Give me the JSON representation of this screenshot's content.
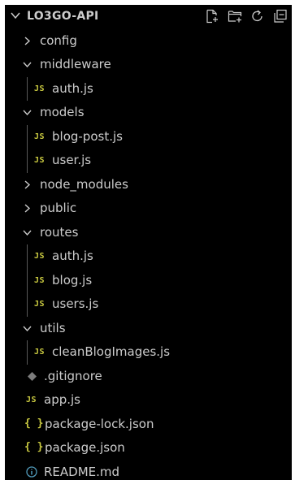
{
  "explorer": {
    "title": "LO3GO-API",
    "actions": [
      "new-file-icon",
      "new-folder-icon",
      "refresh-icon",
      "collapse-all-icon"
    ]
  },
  "tree": [
    {
      "label": "config",
      "type": "folder",
      "expanded": false,
      "depth": 1
    },
    {
      "label": "middleware",
      "type": "folder",
      "expanded": true,
      "depth": 1
    },
    {
      "label": "auth.js",
      "type": "js",
      "depth": 2
    },
    {
      "label": "models",
      "type": "folder",
      "expanded": true,
      "depth": 1
    },
    {
      "label": "blog-post.js",
      "type": "js",
      "depth": 2
    },
    {
      "label": "user.js",
      "type": "js",
      "depth": 2
    },
    {
      "label": "node_modules",
      "type": "folder",
      "expanded": false,
      "depth": 1
    },
    {
      "label": "public",
      "type": "folder",
      "expanded": false,
      "depth": 1
    },
    {
      "label": "routes",
      "type": "folder",
      "expanded": true,
      "depth": 1
    },
    {
      "label": "auth.js",
      "type": "js",
      "depth": 2
    },
    {
      "label": "blog.js",
      "type": "js",
      "depth": 2
    },
    {
      "label": "users.js",
      "type": "js",
      "depth": 2
    },
    {
      "label": "utils",
      "type": "folder",
      "expanded": true,
      "depth": 1
    },
    {
      "label": "cleanBlogImages.js",
      "type": "js",
      "depth": 2
    },
    {
      "label": ".gitignore",
      "type": "git",
      "depth": 1
    },
    {
      "label": "app.js",
      "type": "js",
      "depth": 1
    },
    {
      "label": "package-lock.json",
      "type": "json",
      "depth": 1
    },
    {
      "label": "package.json",
      "type": "json",
      "depth": 1
    },
    {
      "label": "README.md",
      "type": "info",
      "depth": 1
    }
  ],
  "badges": {
    "js": "JS",
    "json": "{ }"
  },
  "colors": {
    "background": "#000000",
    "text": "#cccccc",
    "js_badge": "#cbcb41",
    "json_badge": "#cbcb41",
    "info": "#519aba",
    "git": "#7d7d7d",
    "guide": "#585858"
  }
}
